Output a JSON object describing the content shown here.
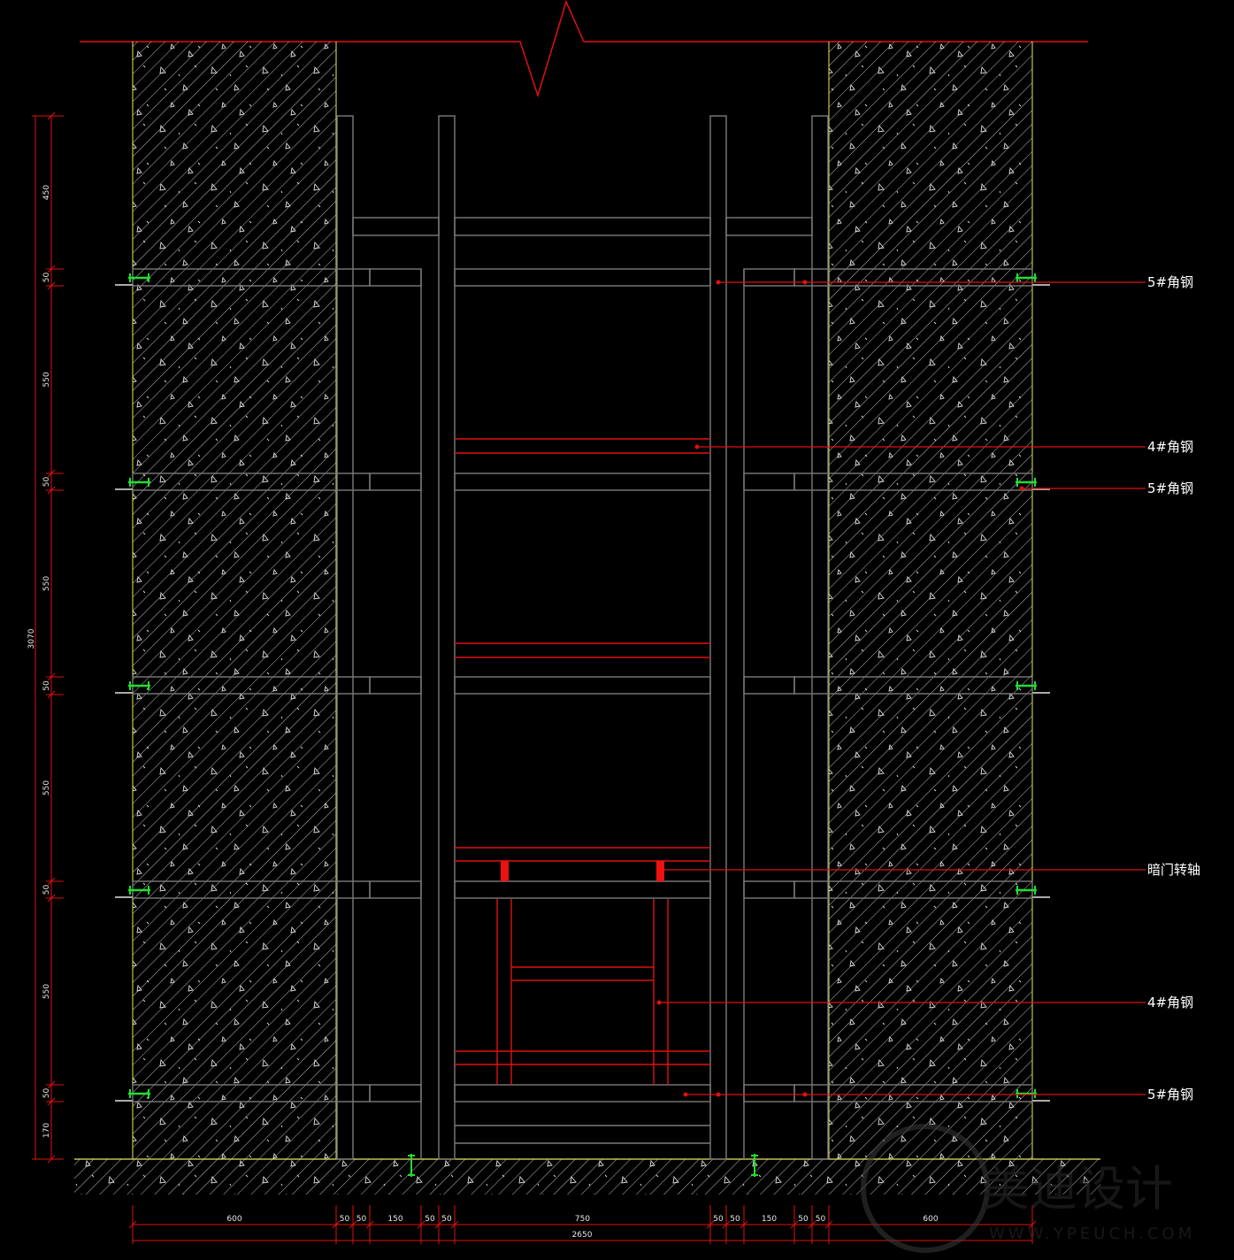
{
  "callouts": [
    {
      "label": "5#角钢"
    },
    {
      "label": "4#角钢"
    },
    {
      "label": "5#角钢"
    },
    {
      "label": "暗门转轴"
    },
    {
      "label": "4#角钢"
    },
    {
      "label": "5#角钢"
    }
  ],
  "vertical_dims": [
    "450",
    "50",
    "550",
    "50",
    "550",
    "50",
    "550",
    "50",
    "550",
    "50",
    "170"
  ],
  "vertical_total": "3070",
  "horizontal_dims": [
    "600",
    "50",
    "50",
    "150",
    "50",
    "50",
    "750",
    "50",
    "50",
    "150",
    "50",
    "50",
    "600"
  ],
  "horizontal_total": "2650",
  "watermark": {
    "text": "美迪设计",
    "url": "WWW.YPEUCH.COM"
  },
  "colors": {
    "frame": "#7a7a7a",
    "red": "#e01010",
    "hatch": "#d8d8d8",
    "wall_edge": "#e8e860",
    "clip": "#22dd33"
  }
}
